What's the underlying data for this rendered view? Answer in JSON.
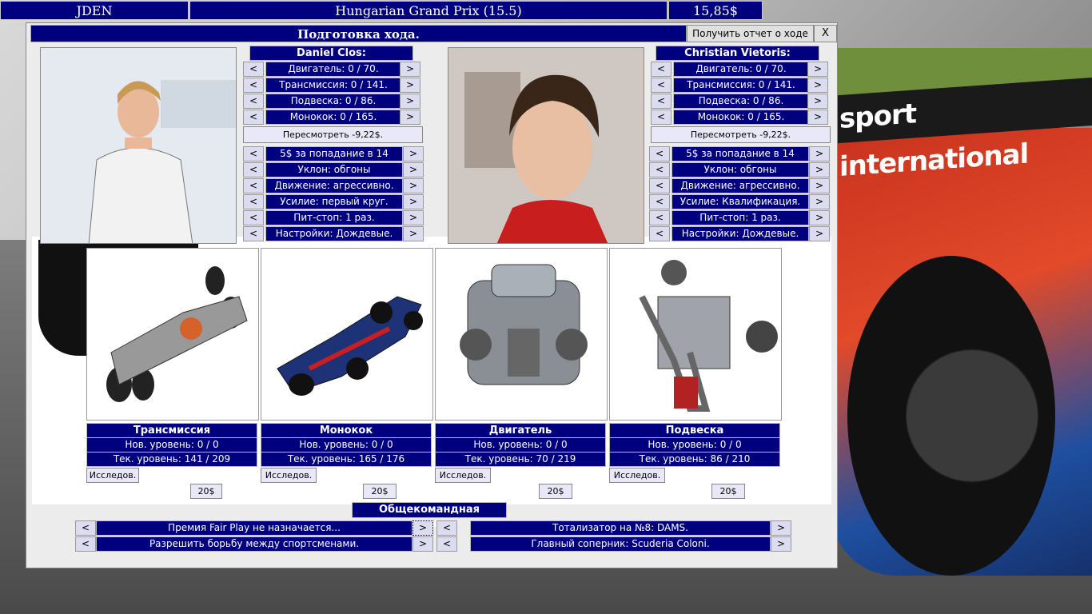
{
  "topbar": {
    "team": "JDEN",
    "race": "Hungarian Grand Prix (15.5)",
    "money": "15,85$"
  },
  "background": {
    "sponsor_text": "sport international"
  },
  "window": {
    "title": "Подготовка хода.",
    "report_button": "Получить отчет о ходе",
    "close_label": "X"
  },
  "arrows": {
    "left": "<",
    "right": ">"
  },
  "drivers": [
    {
      "name": "Daniel Clos:",
      "components": [
        "Двигатель: 0 / 70.",
        "Трансмиссия: 0 / 141.",
        "Подвеска: 0 / 86.",
        "Монокок: 0 / 165."
      ],
      "review": "Пересмотреть -9,22$.",
      "settings": [
        "5$ за попадание в 14",
        "Уклон: обгоны",
        "Движение: агрессивно.",
        "Усилие: первый круг.",
        "Пит-стоп: 1 раз.",
        "Настройки: Дождевые."
      ]
    },
    {
      "name": "Christian Vietoris:",
      "components": [
        "Двигатель: 0 / 70.",
        "Трансмиссия: 0 / 141.",
        "Подвеска: 0 / 86.",
        "Монокок: 0 / 165."
      ],
      "review": "Пересмотреть -9,22$.",
      "settings": [
        "5$ за попадание в 14",
        "Уклон: обгоны",
        "Движение: агрессивно.",
        "Усилие: Квалификация.",
        "Пит-стоп: 1 раз.",
        "Настройки: Дождевые."
      ]
    }
  ],
  "research": [
    {
      "title": "Трансмиссия",
      "new_level": "Нов. уровень: 0 / 0",
      "cur_level": "Тек. уровень: 141 / 209",
      "button": "Исследов.",
      "price": "20$"
    },
    {
      "title": "Монокок",
      "new_level": "Нов. уровень: 0 / 0",
      "cur_level": "Тек. уровень: 165 / 176",
      "button": "Исследов.",
      "price": "20$"
    },
    {
      "title": "Двигатель",
      "new_level": "Нов. уровень: 0 / 0",
      "cur_level": "Тек. уровень: 70 / 219",
      "button": "Исследов.",
      "price": "20$"
    },
    {
      "title": "Подвеска",
      "new_level": "Нов. уровень: 0 / 0",
      "cur_level": "Тек. уровень: 86 / 210",
      "button": "Исследов.",
      "price": "20$"
    }
  ],
  "team_tactics": {
    "title": "Общекомандная тактика:",
    "left": [
      "Премия Fair Play не назначается...",
      "Разрешить борьбу между спортсменами."
    ],
    "right": [
      "Тотализатор на №8: DAMS.",
      "Главный соперник: Scuderia Coloni."
    ]
  }
}
